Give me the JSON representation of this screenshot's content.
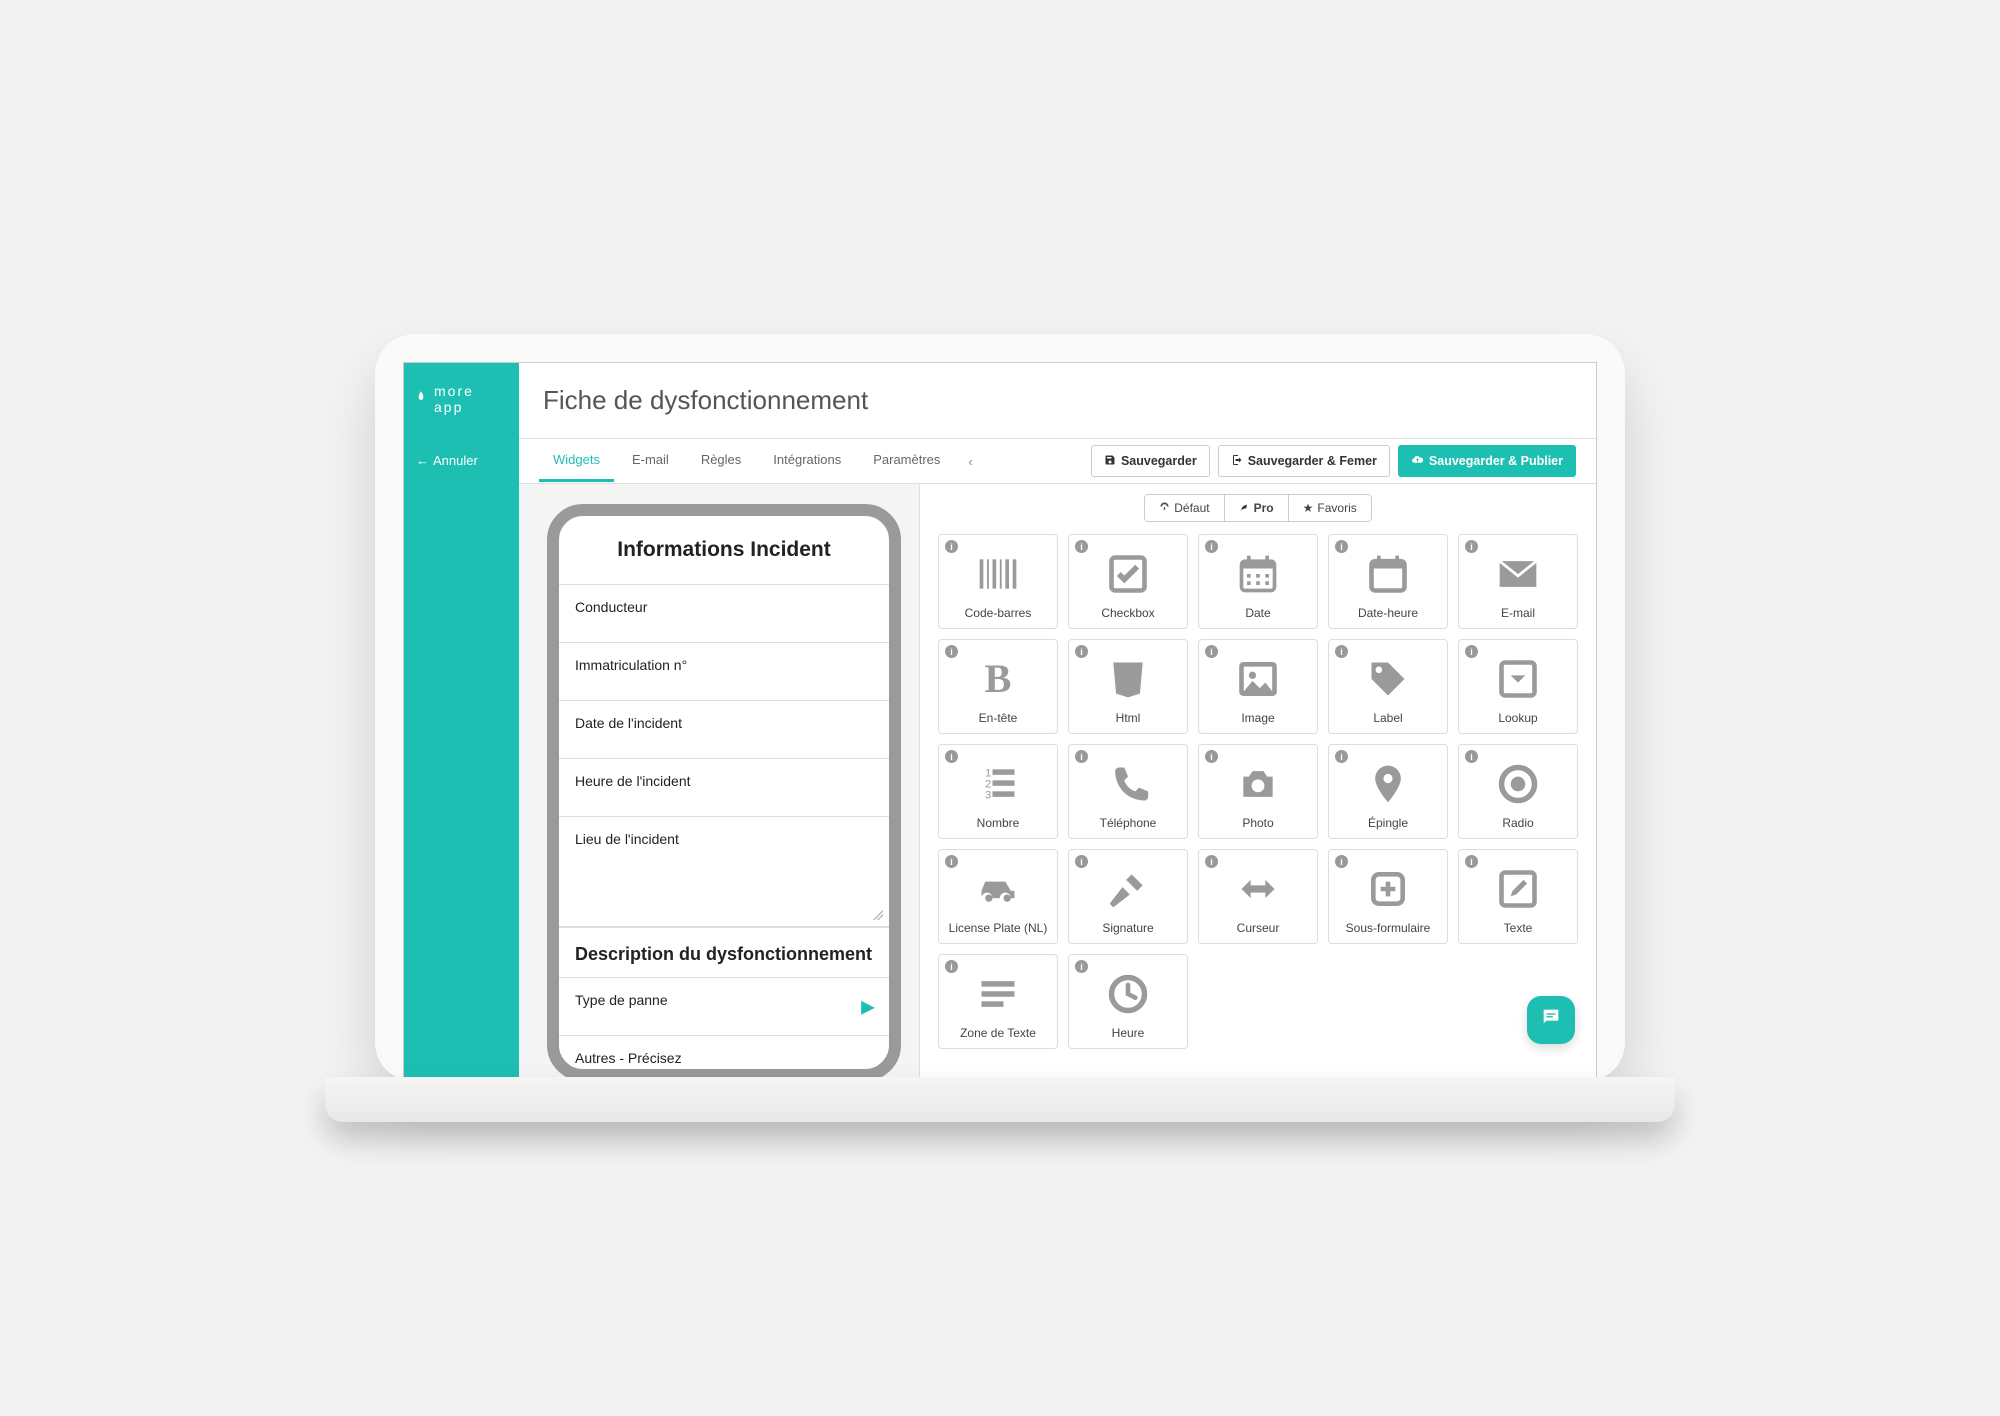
{
  "brand": "more app",
  "header": {
    "cancel": "Annuler",
    "title": "Fiche de dysfonctionnement"
  },
  "tabs": {
    "items": [
      "Widgets",
      "E-mail",
      "Règles",
      "Intégrations",
      "Paramètres"
    ],
    "activeIndex": 0
  },
  "actions": {
    "save": "Sauvegarder",
    "saveClose": "Sauvegarder & Femer",
    "savePublish": "Sauvegarder & Publier"
  },
  "form": {
    "section1_title": "Informations Incident",
    "fields": [
      {
        "label": "Conducteur"
      },
      {
        "label": "Immatriculation n°"
      },
      {
        "label": "Date de l'incident"
      },
      {
        "label": "Heure de l'incident"
      },
      {
        "label": "Lieu de l'incident",
        "tall": true
      }
    ],
    "section2_title": "Description du dysfonctionnement",
    "fields2": [
      {
        "label": "Type de panne",
        "chevron": true
      },
      {
        "label": "Autres - Précisez"
      }
    ]
  },
  "widget_categories": {
    "default": "Défaut",
    "pro": "Pro",
    "favorites": "Favoris",
    "activeIndex": 1
  },
  "widgets": [
    {
      "label": "Code-barres",
      "icon": "barcode"
    },
    {
      "label": "Checkbox",
      "icon": "checkbox"
    },
    {
      "label": "Date",
      "icon": "calendar-grid"
    },
    {
      "label": "Date-heure",
      "icon": "calendar-blank"
    },
    {
      "label": "E-mail",
      "icon": "envelope"
    },
    {
      "label": "En-tête",
      "icon": "header-b"
    },
    {
      "label": "Html",
      "icon": "html5"
    },
    {
      "label": "Image",
      "icon": "image"
    },
    {
      "label": "Label",
      "icon": "tag"
    },
    {
      "label": "Lookup",
      "icon": "lookup"
    },
    {
      "label": "Nombre",
      "icon": "number-list"
    },
    {
      "label": "Téléphone",
      "icon": "phone"
    },
    {
      "label": "Photo",
      "icon": "camera"
    },
    {
      "label": "Épingle",
      "icon": "pin"
    },
    {
      "label": "Radio",
      "icon": "radio"
    },
    {
      "label": "License Plate (NL)",
      "icon": "car"
    },
    {
      "label": "Signature",
      "icon": "gavel"
    },
    {
      "label": "Curseur",
      "icon": "slider-arrows"
    },
    {
      "label": "Sous-formulaire",
      "icon": "plus-box"
    },
    {
      "label": "Texte",
      "icon": "edit-box"
    },
    {
      "label": "Zone de Texte",
      "icon": "text-lines"
    },
    {
      "label": "Heure",
      "icon": "clock"
    }
  ]
}
